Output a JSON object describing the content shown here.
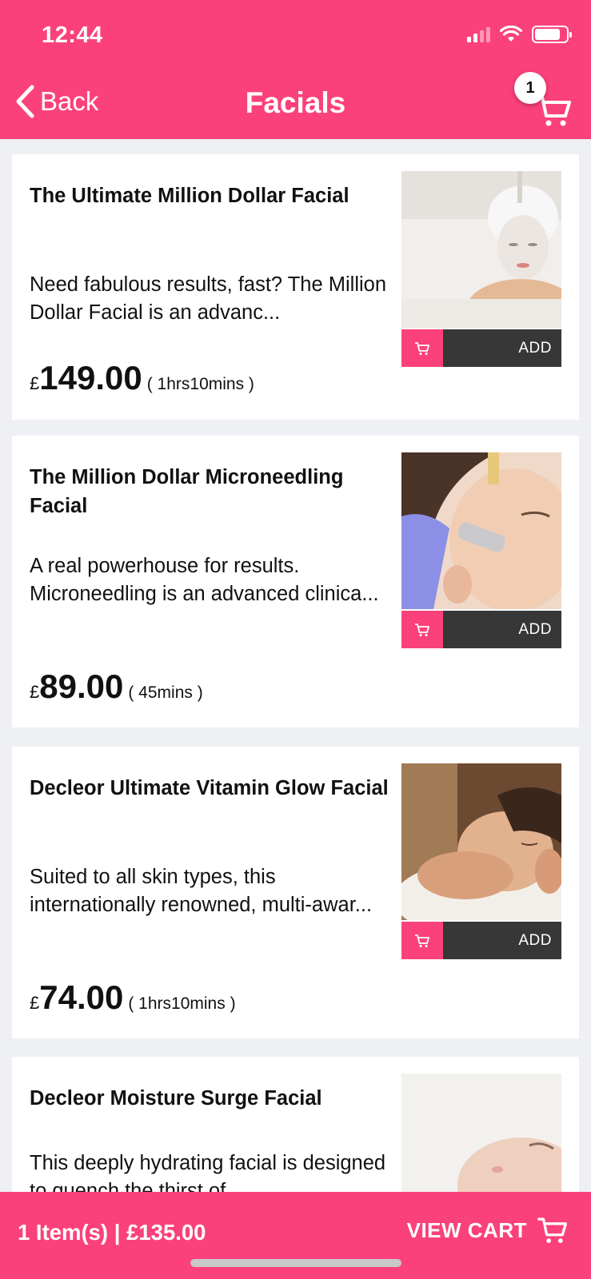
{
  "status_bar": {
    "time": "12:44"
  },
  "nav": {
    "back_label": "Back",
    "title": "Facials",
    "cart_count": "1"
  },
  "products": [
    {
      "title": "The Ultimate Million Dollar Facial",
      "description": "Need fabulous results, fast? The Million Dollar Facial is an advanc...",
      "currency": "£",
      "price": "149.00",
      "duration": "( 1hrs10mins )",
      "add_label": "ADD"
    },
    {
      "title": "The Million Dollar Microneedling Facial",
      "description": "A real powerhouse for results. Microneedling is an advanced clinica...",
      "currency": "£",
      "price": "89.00",
      "duration": "( 45mins )",
      "add_label": "ADD"
    },
    {
      "title": "Decleor Ultimate Vitamin Glow Facial",
      "description": "Suited to all skin types, this internationally renowned, multi-awar...",
      "currency": "£",
      "price": "74.00",
      "duration": "( 1hrs10mins )",
      "add_label": "ADD"
    },
    {
      "title": "Decleor Moisture Surge Facial",
      "description": "This deeply hydrating facial is designed to quench the thirst of..."
    }
  ],
  "footer": {
    "summary": "1 Item(s) | £135.00",
    "view_cart_label": "VIEW CART"
  },
  "colors": {
    "brand_pink": "#fb417c",
    "add_bar_dark": "#373737",
    "background": "#eef0f4"
  }
}
